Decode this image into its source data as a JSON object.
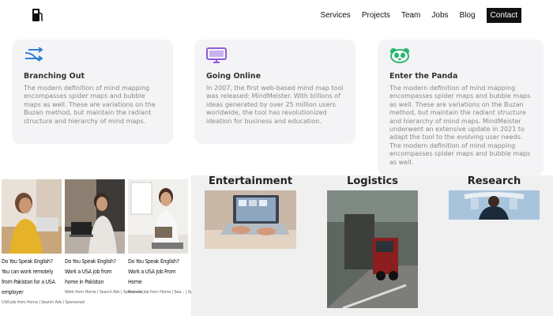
{
  "nav": {
    "items": [
      "Services",
      "Projects",
      "Team",
      "Jobs",
      "Blog"
    ],
    "contact": "Contact"
  },
  "cards": [
    {
      "title": "Branching Out",
      "icon": "arrows-icon",
      "text": "The modern definition of mind mapping encompasses spider maps and bubble maps as well. These are variations on the Buzan method, but maintain the radiant structure and hierarchy of mind maps."
    },
    {
      "title": "Going Online",
      "icon": "monitor-icon",
      "text": "In 2007, the first web-based mind map tool was released: MindMeister. With billions of ideas generated by over 25 million users worldwide, the tool has revolutionized ideation for business and education."
    },
    {
      "title": "Enter the Panda",
      "icon": "panda-icon",
      "text": "The modern definition of mind mapping encompasses spider maps and bubble maps as well. These are variations on the Buzan method, but maintain the radiant structure and hierarchy of mind maps. MindMeister underwent an extensive update in 2021 to adapt the tool to the evolving user needs. The modern definition of mind mapping encompasses spider maps and bubble maps as well."
    }
  ],
  "articles": [
    {
      "title": "Do You Speak English? You can work remotely from Pakistan for a USA employer",
      "source": "USA Job from Home | Search Ads | Sponsored"
    },
    {
      "title": "Do You Speak English? Work a USA job from home in Pakistan",
      "source": "Work from Home | Search Ads | Sponsored"
    },
    {
      "title": "Do You Speak English? Work a USA Job From Home",
      "source": "Remote Job from Home | Sea... | Sponsored"
    }
  ],
  "categories": [
    {
      "title": "Entertainment"
    },
    {
      "title": "Logistics"
    },
    {
      "title": "Research"
    }
  ],
  "colors": {
    "accent_blue": "#2f7fd6",
    "accent_purple": "#8e5bd8",
    "accent_green": "#2bb673",
    "card_bg": "#f4f4f6"
  }
}
